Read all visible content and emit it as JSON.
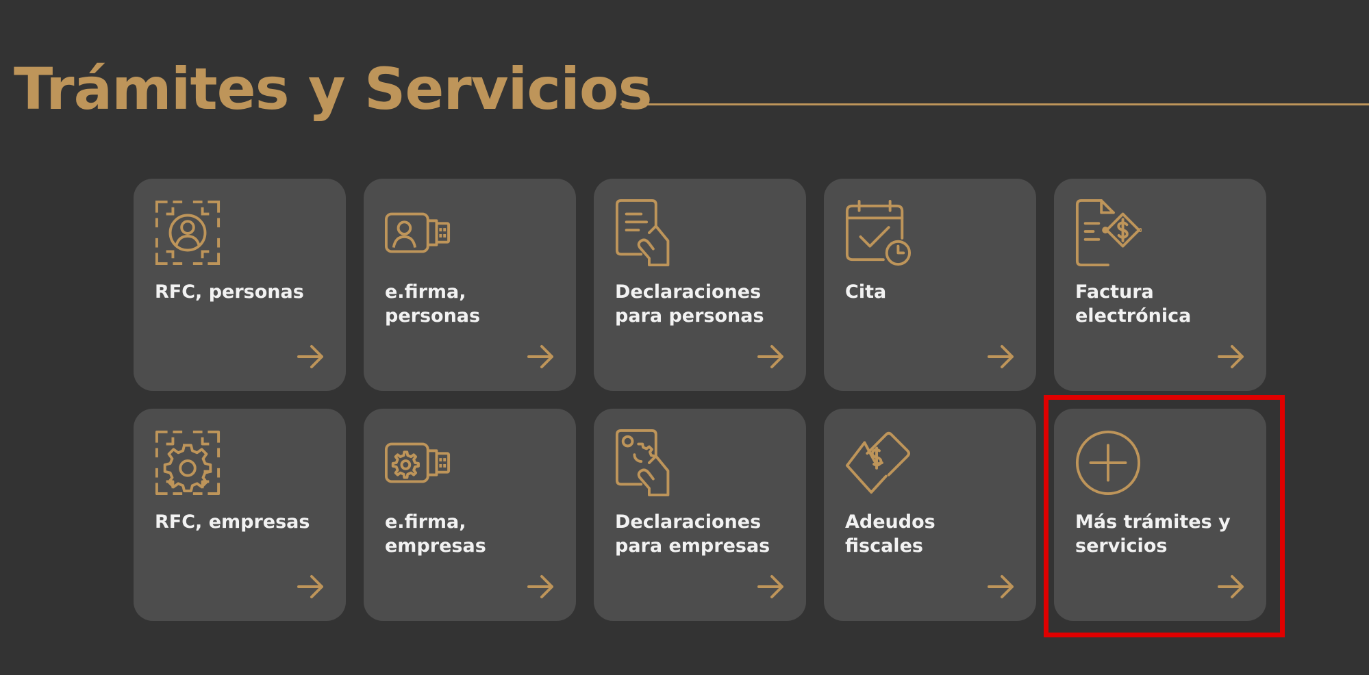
{
  "header": {
    "title": "Trámites y Servicios"
  },
  "colors": {
    "background": "#333333",
    "card": "#4D4D4D",
    "accent": "#BE955A",
    "card_text": "#F2F2F2",
    "highlight": "#E00000"
  },
  "cards": [
    {
      "label": "RFC, personas",
      "icon": "id-face-scan-icon"
    },
    {
      "label": "e.firma, personas",
      "icon": "usb-token-user-icon"
    },
    {
      "label": "Declaraciones para personas",
      "icon": "document-hand-icon"
    },
    {
      "label": "Cita",
      "icon": "calendar-check-icon"
    },
    {
      "label": "Factura electrónica",
      "icon": "invoice-dollar-icon"
    },
    {
      "label": "RFC, empresas",
      "icon": "gear-scan-icon"
    },
    {
      "label": "e.firma, empresas",
      "icon": "usb-token-gear-icon"
    },
    {
      "label": "Declaraciones para empresas",
      "icon": "document-gear-hand-icon"
    },
    {
      "label": "Adeudos fiscales",
      "icon": "hand-dollar-bill-icon"
    },
    {
      "label": "Más trámites y servicios",
      "icon": "plus-circle-icon"
    }
  ]
}
